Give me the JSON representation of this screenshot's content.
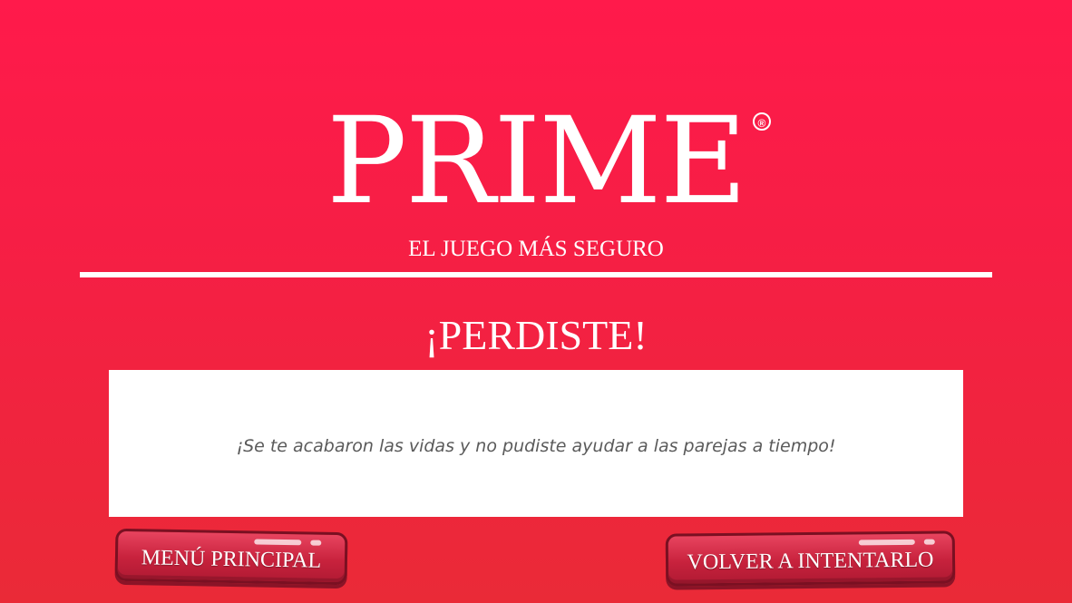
{
  "brand": {
    "logo": "PRIME",
    "registered_mark": "®",
    "tagline": "EL JUEGO MÁS SEGURO"
  },
  "result": {
    "title": "¡PERDISTE!",
    "message": "¡Se te acabaron las vidas y no pudiste ayudar a las parejas a tiempo!"
  },
  "buttons": {
    "main_menu": "MENÚ PRINCIPAL",
    "retry": "VOLVER A INTENTARLO"
  },
  "colors": {
    "background_top": "#ff1a4b",
    "background_bottom": "#ea2a37",
    "button": "#c8223d",
    "panel": "#ffffff",
    "message_text": "#5a5a5a"
  }
}
